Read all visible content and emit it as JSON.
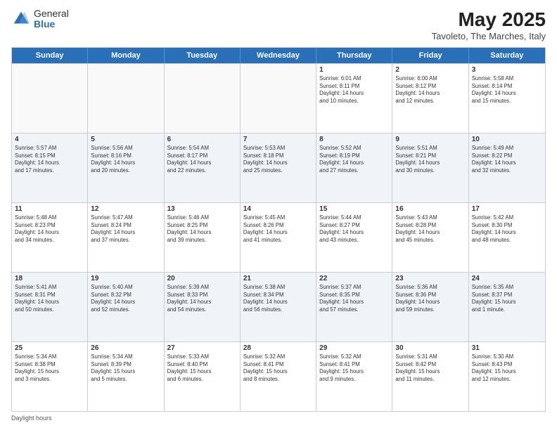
{
  "header": {
    "logo_general": "General",
    "logo_blue": "Blue",
    "title": "May 2025",
    "subtitle": "Tavoleto, The Marches, Italy"
  },
  "days_of_week": [
    "Sunday",
    "Monday",
    "Tuesday",
    "Wednesday",
    "Thursday",
    "Friday",
    "Saturday"
  ],
  "weeks": [
    [
      {
        "day": "",
        "info": ""
      },
      {
        "day": "",
        "info": ""
      },
      {
        "day": "",
        "info": ""
      },
      {
        "day": "",
        "info": ""
      },
      {
        "day": "1",
        "info": "Sunrise: 6:01 AM\nSunset: 8:11 PM\nDaylight: 14 hours\nand 10 minutes."
      },
      {
        "day": "2",
        "info": "Sunrise: 6:00 AM\nSunset: 8:12 PM\nDaylight: 14 hours\nand 12 minutes."
      },
      {
        "day": "3",
        "info": "Sunrise: 5:58 AM\nSunset: 8:14 PM\nDaylight: 14 hours\nand 15 minutes."
      }
    ],
    [
      {
        "day": "4",
        "info": "Sunrise: 5:57 AM\nSunset: 8:15 PM\nDaylight: 14 hours\nand 17 minutes."
      },
      {
        "day": "5",
        "info": "Sunrise: 5:56 AM\nSunset: 8:16 PM\nDaylight: 14 hours\nand 20 minutes."
      },
      {
        "day": "6",
        "info": "Sunrise: 5:54 AM\nSunset: 8:17 PM\nDaylight: 14 hours\nand 22 minutes."
      },
      {
        "day": "7",
        "info": "Sunrise: 5:53 AM\nSunset: 8:18 PM\nDaylight: 14 hours\nand 25 minutes."
      },
      {
        "day": "8",
        "info": "Sunrise: 5:52 AM\nSunset: 8:19 PM\nDaylight: 14 hours\nand 27 minutes."
      },
      {
        "day": "9",
        "info": "Sunrise: 5:51 AM\nSunset: 8:21 PM\nDaylight: 14 hours\nand 30 minutes."
      },
      {
        "day": "10",
        "info": "Sunrise: 5:49 AM\nSunset: 8:22 PM\nDaylight: 14 hours\nand 32 minutes."
      }
    ],
    [
      {
        "day": "11",
        "info": "Sunrise: 5:48 AM\nSunset: 8:23 PM\nDaylight: 14 hours\nand 34 minutes."
      },
      {
        "day": "12",
        "info": "Sunrise: 5:47 AM\nSunset: 8:24 PM\nDaylight: 14 hours\nand 37 minutes."
      },
      {
        "day": "13",
        "info": "Sunrise: 5:46 AM\nSunset: 8:25 PM\nDaylight: 14 hours\nand 39 minutes."
      },
      {
        "day": "14",
        "info": "Sunrise: 5:45 AM\nSunset: 8:26 PM\nDaylight: 14 hours\nand 41 minutes."
      },
      {
        "day": "15",
        "info": "Sunrise: 5:44 AM\nSunset: 8:27 PM\nDaylight: 14 hours\nand 43 minutes."
      },
      {
        "day": "16",
        "info": "Sunrise: 5:43 AM\nSunset: 8:28 PM\nDaylight: 14 hours\nand 45 minutes."
      },
      {
        "day": "17",
        "info": "Sunrise: 5:42 AM\nSunset: 8:30 PM\nDaylight: 14 hours\nand 48 minutes."
      }
    ],
    [
      {
        "day": "18",
        "info": "Sunrise: 5:41 AM\nSunset: 8:31 PM\nDaylight: 14 hours\nand 50 minutes."
      },
      {
        "day": "19",
        "info": "Sunrise: 5:40 AM\nSunset: 8:32 PM\nDaylight: 14 hours\nand 52 minutes."
      },
      {
        "day": "20",
        "info": "Sunrise: 5:39 AM\nSunset: 8:33 PM\nDaylight: 14 hours\nand 54 minutes."
      },
      {
        "day": "21",
        "info": "Sunrise: 5:38 AM\nSunset: 8:34 PM\nDaylight: 14 hours\nand 56 minutes."
      },
      {
        "day": "22",
        "info": "Sunrise: 5:37 AM\nSunset: 8:35 PM\nDaylight: 14 hours\nand 57 minutes."
      },
      {
        "day": "23",
        "info": "Sunrise: 5:36 AM\nSunset: 8:36 PM\nDaylight: 14 hours\nand 59 minutes."
      },
      {
        "day": "24",
        "info": "Sunrise: 5:35 AM\nSunset: 8:37 PM\nDaylight: 15 hours\nand 1 minute."
      }
    ],
    [
      {
        "day": "25",
        "info": "Sunrise: 5:34 AM\nSunset: 8:38 PM\nDaylight: 15 hours\nand 3 minutes."
      },
      {
        "day": "26",
        "info": "Sunrise: 5:34 AM\nSunset: 8:39 PM\nDaylight: 15 hours\nand 5 minutes."
      },
      {
        "day": "27",
        "info": "Sunrise: 5:33 AM\nSunset: 8:40 PM\nDaylight: 15 hours\nand 6 minutes."
      },
      {
        "day": "28",
        "info": "Sunrise: 5:32 AM\nSunset: 8:41 PM\nDaylight: 15 hours\nand 8 minutes."
      },
      {
        "day": "29",
        "info": "Sunrise: 5:32 AM\nSunset: 8:41 PM\nDaylight: 15 hours\nand 9 minutes."
      },
      {
        "day": "30",
        "info": "Sunrise: 5:31 AM\nSunset: 8:42 PM\nDaylight: 15 hours\nand 11 minutes."
      },
      {
        "day": "31",
        "info": "Sunrise: 5:30 AM\nSunset: 8:43 PM\nDaylight: 15 hours\nand 12 minutes."
      }
    ]
  ],
  "legend": {
    "label": "Daylight hours"
  }
}
